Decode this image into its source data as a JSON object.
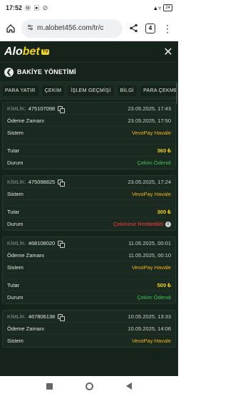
{
  "status_bar": {
    "time": "17:52",
    "icons": "Ⓜ ▣ ⊘",
    "signal": "▲▿",
    "battery": "24"
  },
  "browser": {
    "url": "m.alobet456.com/tr/c",
    "tabs": "4",
    "menu": "⋮"
  },
  "app": {
    "logo_a": "Alo",
    "logo_bet": "bet",
    "logo_tv": "TV",
    "close": "✕",
    "page_title": "BAKİYE YÖNETİMİ",
    "back": "❮"
  },
  "tabs": [
    "PARA YATIR",
    "ÇEKİM",
    "İŞLEM GEÇMİŞİ",
    "BİLGİ",
    "PARA ÇEKME"
  ],
  "labels": {
    "kimlik": "KİMLİK:",
    "odeme": "Ödeme Zamanı",
    "sistem": "Sistem",
    "tutar": "Tutar",
    "durum": "Durum"
  },
  "records": [
    {
      "id": "475107098",
      "date": "23.05.2025, 17:43",
      "payment_time": "23.05.2025, 17:50",
      "system": "VevoPay Havale",
      "amount": "360 ₺",
      "status": "Çekim Ödendi",
      "status_type": "ok"
    },
    {
      "id": "475098825",
      "date": "23.05.2025, 17:24",
      "payment_time": "",
      "system": "VevoPay Havale",
      "amount": "300 ₺",
      "status": "Çekiminiz Reddedildi",
      "status_type": "rej"
    },
    {
      "id": "468108020",
      "date": "11.05.2025, 00:01",
      "payment_time": "11.05.2025, 00:10",
      "system": "VevoPay Havale",
      "amount": "500 ₺",
      "status": "Çekim Ödendi",
      "status_type": "ok"
    },
    {
      "id": "467806138",
      "date": "10.05.2025, 13:33",
      "payment_time": "10.05.2025, 14:06",
      "system": "VevoPay Havale",
      "amount": "",
      "status": "",
      "status_type": ""
    }
  ],
  "colors": {
    "bg": "#15231b",
    "accent": "#f4d21a",
    "vevo": "#f4b31a",
    "ok": "#3fc25a",
    "rej": "#ff3b3b"
  }
}
